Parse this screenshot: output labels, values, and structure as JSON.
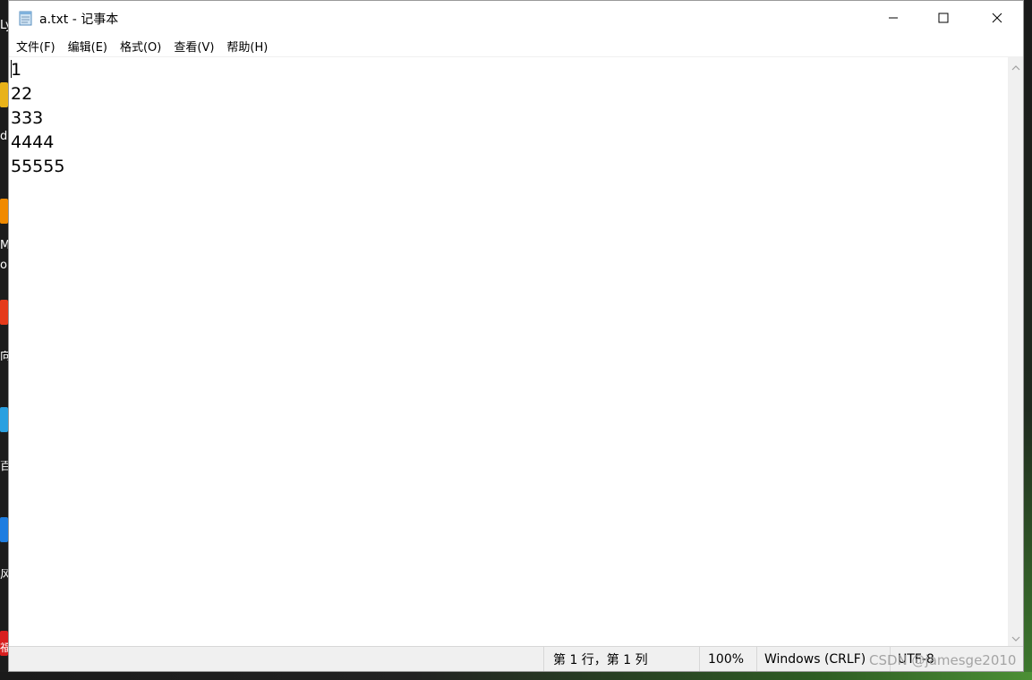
{
  "window": {
    "title": "a.txt - 记事本"
  },
  "menu": {
    "items": [
      {
        "label": "文件(F)"
      },
      {
        "label": "编辑(E)"
      },
      {
        "label": "格式(O)"
      },
      {
        "label": "查看(V)"
      },
      {
        "label": "帮助(H)"
      }
    ]
  },
  "editor": {
    "lines": [
      "1",
      "22",
      "333",
      "4444",
      "55555"
    ]
  },
  "status": {
    "position": "第 1 行，第 1 列",
    "zoom": "100%",
    "line_ending": "Windows (CRLF)",
    "encoding": "UTF-8"
  },
  "watermark": "CSDN @jamesge2010",
  "desktop": {
    "fragments": [
      "Ly",
      "d",
      "M",
      "o",
      "向",
      "百",
      "风",
      "福"
    ]
  },
  "colors": {
    "accent_close": "#e81123",
    "statusbar_bg": "#f0f0f0",
    "window_bg": "#ffffff"
  },
  "icons": {
    "app": "notepad-icon",
    "minimize": "minimize-icon",
    "maximize": "maximize-icon",
    "close": "close-icon"
  }
}
